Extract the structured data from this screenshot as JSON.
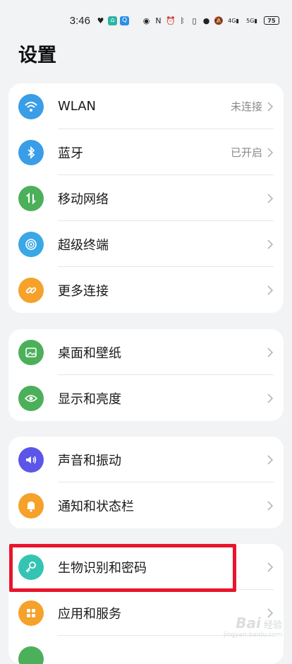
{
  "status_bar": {
    "time": "3:46",
    "battery": "75",
    "icons": [
      "heart-icon",
      "app-icon",
      "search-app-icon",
      "eye-icon",
      "nfc-icon",
      "alarm-icon",
      "bluetooth-icon",
      "battery-saver-icon",
      "location-icon",
      "mute-icon",
      "signal-4g-icon",
      "signal-5g-icon",
      "battery-icon"
    ],
    "signal_4g": "4G",
    "signal_5g": "5G"
  },
  "page": {
    "title": "设置"
  },
  "groups": [
    {
      "items": [
        {
          "label": "WLAN",
          "value": "未连接",
          "icon": "wifi-icon",
          "color": "#3a9de8"
        },
        {
          "label": "蓝牙",
          "value": "已开启",
          "icon": "bluetooth-icon",
          "color": "#3a9de8"
        },
        {
          "label": "移动网络",
          "value": "",
          "icon": "mobile-data-icon",
          "color": "#4cb05a"
        },
        {
          "label": "超级终端",
          "value": "",
          "icon": "super-device-icon",
          "color": "#3aa7e6"
        },
        {
          "label": "更多连接",
          "value": "",
          "icon": "link-icon",
          "color": "#f5a12a"
        }
      ]
    },
    {
      "items": [
        {
          "label": "桌面和壁纸",
          "value": "",
          "icon": "wallpaper-icon",
          "color": "#4cb05a"
        },
        {
          "label": "显示和亮度",
          "value": "",
          "icon": "eye-icon",
          "color": "#4cb05a"
        }
      ]
    },
    {
      "items": [
        {
          "label": "声音和振动",
          "value": "",
          "icon": "speaker-icon",
          "color": "#5b56e8"
        },
        {
          "label": "通知和状态栏",
          "value": "",
          "icon": "bell-icon",
          "color": "#f5a12a"
        }
      ]
    },
    {
      "items": [
        {
          "label": "生物识别和密码",
          "value": "",
          "icon": "key-icon",
          "color": "#34c4b3"
        },
        {
          "label": "应用和服务",
          "value": "",
          "icon": "apps-icon",
          "color": "#f5a12a"
        },
        {
          "label": "",
          "value": "",
          "icon": "partial-icon",
          "color": "#4cb05a"
        }
      ]
    }
  ],
  "watermark": {
    "main": "Bai",
    "main_suffix": "经验",
    "sub": "jingyan.baidu.com"
  },
  "colors": {
    "background": "#f1f3f5",
    "card": "#ffffff",
    "highlight": "#e8152c"
  }
}
